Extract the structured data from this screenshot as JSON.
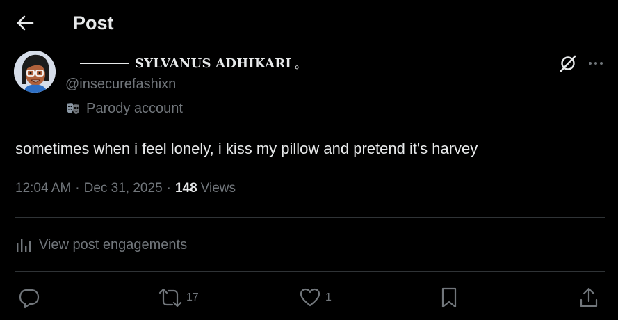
{
  "header": {
    "title": "Post",
    "back_icon": "arrow-left-icon"
  },
  "author": {
    "display_name": "SYLVANUS ADHIKARI",
    "name_suffix": "。",
    "handle": "@insecurefashixn",
    "label": "Parody account",
    "label_icon": "parody-mask-icon"
  },
  "post": {
    "text": "sometimes when i feel lonely, i kiss my pillow and pretend it's harvey",
    "time": "12:04 AM",
    "date": "Dec 31, 2025",
    "views_count": "148",
    "views_label": "Views"
  },
  "engagements": {
    "label": "View post engagements",
    "icon": "analytics-bars-icon"
  },
  "actions": {
    "reply": {
      "icon": "reply-icon",
      "count": ""
    },
    "repost": {
      "icon": "repost-icon",
      "count": "17"
    },
    "like": {
      "icon": "heart-icon",
      "count": "1"
    },
    "bookmark": {
      "icon": "bookmark-icon",
      "count": ""
    },
    "share": {
      "icon": "share-icon",
      "count": ""
    }
  },
  "top_right": {
    "grok_icon": "grok-icon",
    "more_icon": "more-dots-icon"
  },
  "colors": {
    "background": "#000000",
    "text_primary": "#e7e9ea",
    "text_secondary": "#71767b",
    "divider": "#2f3336"
  }
}
